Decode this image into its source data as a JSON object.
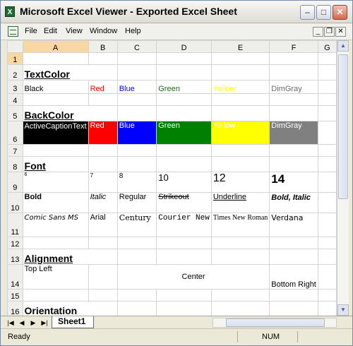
{
  "window": {
    "title": "Microsoft Excel Viewer - Exported Excel Sheet"
  },
  "menu": [
    "File",
    "Edit",
    "View",
    "Window",
    "Help"
  ],
  "titlebar_buttons": {
    "minimize": "–",
    "maximize": "□",
    "close": "✕"
  },
  "mdi_buttons": {
    "minimize": "_",
    "restore": "❐",
    "close": "✕"
  },
  "columns": [
    "A",
    "B",
    "C",
    "D",
    "E",
    "F",
    "G"
  ],
  "active_cell": "A1",
  "rows": {
    "r1": "1",
    "r2": "2",
    "r3": "3",
    "r4": "4",
    "r5": "5",
    "r6": "6",
    "r7": "7",
    "r8": "8",
    "r9": "9",
    "r10": "10",
    "r11": "11",
    "r12": "12",
    "r13": "13",
    "r14": "14",
    "r15": "15",
    "r16": "16"
  },
  "textcolor": {
    "header": "TextColor",
    "cells": [
      {
        "label": "Black",
        "color": "#000000"
      },
      {
        "label": "Red",
        "color": "#ff0000"
      },
      {
        "label": "Blue",
        "color": "#0000ff"
      },
      {
        "label": "Green",
        "color": "#008000"
      },
      {
        "label": "Yellow",
        "color": "#ffff00"
      },
      {
        "label": "DimGray",
        "color": "#696969"
      }
    ]
  },
  "backcolor": {
    "header": "BackColor",
    "cells": [
      {
        "label": "ActiveCaptionText",
        "background": "#000000",
        "text_color": "#ffffff"
      },
      {
        "label": "Red",
        "background": "#ff0000",
        "text_color": "#ffffff"
      },
      {
        "label": "Blue",
        "background": "#0000ff",
        "text_color": "#ffffff"
      },
      {
        "label": "Green",
        "background": "#008000",
        "text_color": "#ffffff"
      },
      {
        "label": "Yellow",
        "background": "#ffff00",
        "text_color": "#ffffff"
      },
      {
        "label": "DimGray",
        "background": "#808080",
        "text_color": "#ffffff"
      }
    ]
  },
  "font": {
    "header": "Font",
    "sizes": [
      "6",
      "7",
      "8",
      "10",
      "12",
      "14"
    ],
    "styles": [
      "Bold",
      "Italic",
      "Regular",
      "Strikeout",
      "Underline",
      "Bold, Italic"
    ],
    "families": [
      "Comic Sans MS",
      "Arial",
      "Century",
      "Courier New",
      "Times New Roman",
      "Verdana"
    ]
  },
  "alignment": {
    "header": "Alignment",
    "top_left": "Top Left",
    "center": "Center",
    "bottom_right": "Bottom Right"
  },
  "orientation": {
    "header": "Orientation"
  },
  "sheet_tabs": [
    "Sheet1"
  ],
  "tab_nav": {
    "first": "|◀",
    "prev": "◀",
    "next": "▶",
    "last": "▶|"
  },
  "status": {
    "left": "Ready",
    "num": "NUM"
  }
}
